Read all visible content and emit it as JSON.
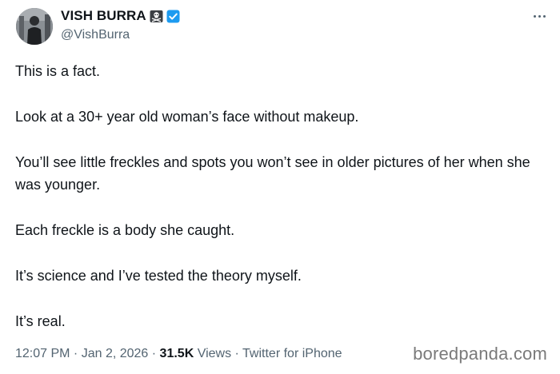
{
  "author": {
    "display_name": "VISH BURRA",
    "handle": "@VishBurra",
    "icons": [
      "skull-and-crossbones-icon",
      "verified-badge-icon"
    ]
  },
  "tweet": {
    "paragraphs": [
      "This is a fact.",
      "Look at a 30+ year old woman’s face without makeup.",
      "You’ll see little freckles and spots you won’t see in older pictures of her when she was younger.",
      "Each freckle is a body she caught.",
      "It’s science and I’ve tested the theory myself.",
      "It’s real."
    ]
  },
  "meta": {
    "time": "12:07 PM",
    "date": "Jan 2, 2026",
    "views_count": "31.5K",
    "views_label": "Views",
    "source": "Twitter for iPhone",
    "separator": " · "
  },
  "watermark": "boredpanda.com",
  "colors": {
    "text": "#0f1419",
    "secondary": "#536471",
    "verified": "#1d9bf0"
  }
}
